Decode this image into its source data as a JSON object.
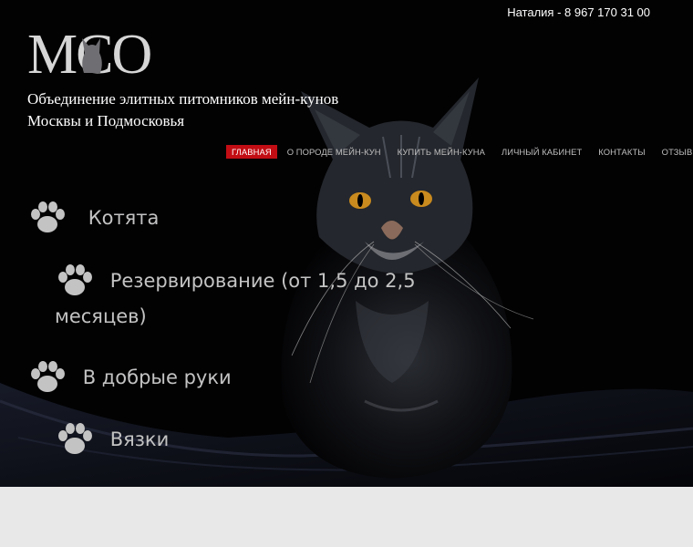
{
  "header": {
    "phone": "Наталия - 8 967 170 31 00",
    "logo_text": "MCO",
    "tagline_line1": "Объединение элитных питомников мейн-кунов",
    "tagline_line2": "Москвы и Подмосковья"
  },
  "nav": {
    "items": [
      {
        "label": "Главная",
        "active": true
      },
      {
        "label": "О породе мейн-кун"
      },
      {
        "label": "Купить мейн-куна"
      },
      {
        "label": "Личный кабинет"
      },
      {
        "label": "Контакты"
      },
      {
        "label": "Отзывы"
      }
    ]
  },
  "menu": {
    "items": [
      {
        "label": "Котята",
        "icon": "paw-icon"
      },
      {
        "label": "Резервирование (от 1,5 до 2,5",
        "label_line2": "месяцев)",
        "icon": "paw-icon"
      },
      {
        "label": "В добрые руки",
        "icon": "paw-icon"
      },
      {
        "label": "Вязки",
        "icon": "paw-icon"
      }
    ]
  },
  "colors": {
    "background": "#020203",
    "active_nav": "#c20d14",
    "menu_text": "#c3c3c3",
    "footer": "#e8e8e8"
  }
}
